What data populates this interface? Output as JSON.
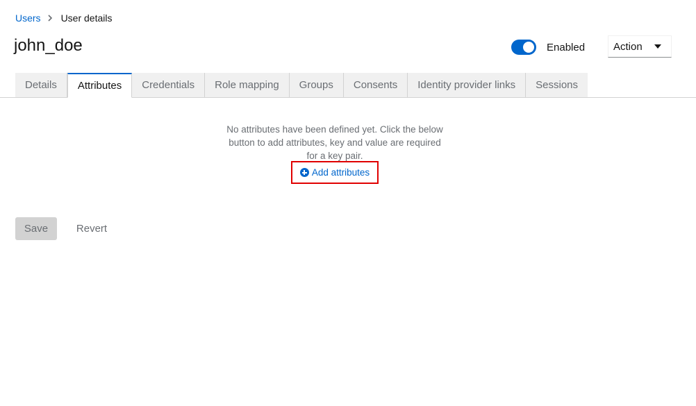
{
  "breadcrumb": {
    "items": [
      "Users",
      "User details"
    ]
  },
  "header": {
    "title": "john_doe",
    "enabled_label": "Enabled",
    "enabled": true,
    "action_label": "Action"
  },
  "tabs": [
    {
      "label": "Details",
      "active": false
    },
    {
      "label": "Attributes",
      "active": true
    },
    {
      "label": "Credentials",
      "active": false
    },
    {
      "label": "Role mapping",
      "active": false
    },
    {
      "label": "Groups",
      "active": false
    },
    {
      "label": "Consents",
      "active": false
    },
    {
      "label": "Identity provider links",
      "active": false
    },
    {
      "label": "Sessions",
      "active": false
    }
  ],
  "empty_state": {
    "message": "No attributes have been defined yet. Click the below button to add attributes, key and value are required for a key pair.",
    "add_label": "Add attributes"
  },
  "footer": {
    "save_label": "Save",
    "revert_label": "Revert"
  },
  "colors": {
    "primary": "#0066cc",
    "highlight": "#e00000"
  }
}
